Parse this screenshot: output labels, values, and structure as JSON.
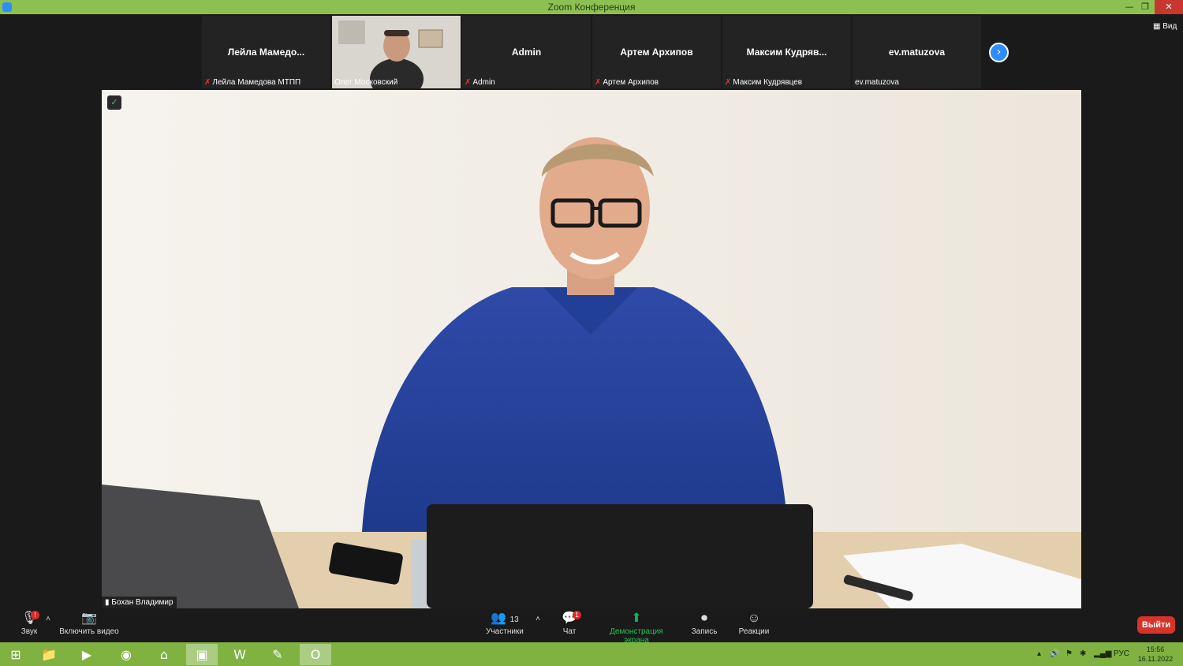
{
  "window": {
    "title": "Zoom Конференция",
    "min_icon": "minimize-icon",
    "max_icon": "restore-icon",
    "close_icon": "close-icon"
  },
  "view_button": "Вид",
  "participants_strip": [
    {
      "display": "Лейла  Мамедо...",
      "caption": "Лейла Мамедова МТПП",
      "muted": true
    },
    {
      "display": "",
      "caption": "Олег Московский",
      "muted": false,
      "video": true
    },
    {
      "display": "Admin",
      "caption": "Admin",
      "muted": true
    },
    {
      "display": "Артем Архипов",
      "caption": "Артем Архипов",
      "muted": true
    },
    {
      "display": "Максим  Кудряв...",
      "caption": "Максим Кудрявцев",
      "muted": true
    },
    {
      "display": "ev.matuzova",
      "caption": "ev.matuzova",
      "muted": false
    }
  ],
  "main_speaker": "Бохан Владимир",
  "toolbar": {
    "audio": "Звук",
    "video": "Включить видео",
    "participants": "Участники",
    "participants_count": "13",
    "chat": "Чат",
    "chat_badge": "1",
    "share": "Демонстрация экрана",
    "record": "Запись",
    "reactions": "Реакции",
    "exit": "Выйти"
  },
  "taskbar": {
    "language": "РУС",
    "time": "15:56",
    "date": "16.11.2022"
  },
  "colors": {
    "titlebar": "#8cc152",
    "taskbar": "#7fb241",
    "accent": "#2d8cff",
    "exit": "#d8332b",
    "share": "#1fb24f"
  }
}
